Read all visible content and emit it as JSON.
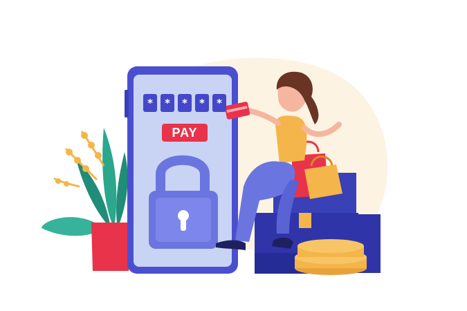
{
  "pin": {
    "digits": [
      "*",
      "*",
      "*",
      "*",
      "*"
    ]
  },
  "pay_button": {
    "label": "PAY"
  },
  "colors": {
    "phone_frame": "#4a4fd0",
    "screen": "#c9d4f5",
    "lock": "#6b75e0",
    "pay_button": "#e8334a",
    "pin_box": "#4347c8",
    "backdrop_blob": "#fdf3e3",
    "boxes": "#2f35a8",
    "coins": "#f4b54a",
    "plant_leaves": "#2aa78c",
    "pot": "#e8334a"
  },
  "icons": [
    "padlock-icon",
    "keyhole-icon",
    "credit-card-icon",
    "shopping-bag-icon",
    "coin-stack-icon",
    "plant-icon"
  ]
}
